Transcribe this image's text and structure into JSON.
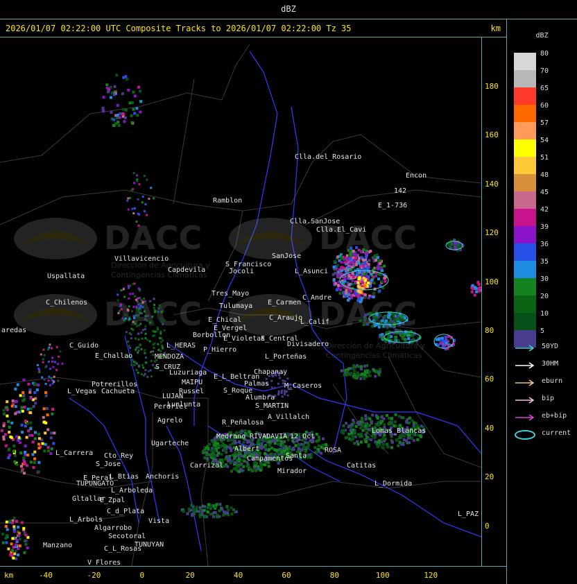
{
  "window": {
    "title": "dBZ"
  },
  "header": {
    "text": "2026/01/07 02:22:00 UTC Composite Tracks to 2026/01/07 02:22:00 Tz 35",
    "km_label": "km"
  },
  "colorbar": {
    "unit": "dBZ",
    "levels": [
      {
        "label": "80",
        "color": "#d8d8d8"
      },
      {
        "label": "70",
        "color": "#b8b8b8"
      },
      {
        "label": "65",
        "color": "#ff3a2a"
      },
      {
        "label": "60",
        "color": "#ff6a00"
      },
      {
        "label": "57",
        "color": "#ff9a5a"
      },
      {
        "label": "54",
        "color": "#ffff00"
      },
      {
        "label": "51",
        "color": "#ffc838"
      },
      {
        "label": "48",
        "color": "#d8903c"
      },
      {
        "label": "45",
        "color": "#c8688c"
      },
      {
        "label": "42",
        "color": "#c8148c"
      },
      {
        "label": "39",
        "color": "#8c14c8"
      },
      {
        "label": "36",
        "color": "#2850e8"
      },
      {
        "label": "35",
        "color": "#1e8ce0"
      },
      {
        "label": "30",
        "color": "#14821e"
      },
      {
        "label": "20",
        "color": "#0a6414"
      },
      {
        "label": "10",
        "color": "#06501a"
      },
      {
        "label": "5",
        "color": "#483c8c"
      }
    ]
  },
  "legend": [
    {
      "label": "50YD",
      "color": "#40d0d8"
    },
    {
      "label": "30HM",
      "color": "#ffffff"
    },
    {
      "label": "eburn",
      "color": "#f0c890"
    },
    {
      "label": "bip",
      "color": "#f0c8e0"
    },
    {
      "label": "eb+bip",
      "color": "#e040e0"
    },
    {
      "label": "current",
      "color": "#40d0d8"
    }
  ],
  "axes": {
    "y_ticks": [
      "180",
      "160",
      "140",
      "120",
      "100",
      "80",
      "60",
      "40",
      "20",
      "0"
    ],
    "x_ticks": [
      "-40",
      "-20",
      "0",
      "20",
      "40",
      "60",
      "80",
      "100",
      "120"
    ],
    "x_unit": "km",
    "y_unit": "km"
  },
  "watermark": {
    "name": "DACC",
    "line1": "Dirección de Agricultura y",
    "line2": "Contingencias Climáticas"
  },
  "places": [
    "Clla.del_Rosario",
    "Encon",
    "E_1-736",
    "142",
    "Ramblon",
    "Clla.SanJose",
    "Clla.El_Cavi",
    "Villavicencio",
    "Capdevila",
    "S_Francisco",
    "SanJose",
    "L_Asunci",
    "Uspallata",
    "Jocoli",
    "Tres_Mayo",
    "Tulumaya",
    "E_Carmen",
    "C_Andre",
    "C_Chilenos",
    "E_Chical",
    "E_Vergel",
    "C_Araujo",
    "L_Calif",
    "aredas",
    "E_Violetas",
    "Borbollon",
    "E_Central",
    "L_HERAS",
    "P_Hierro",
    "Divisadero",
    "C_Guido",
    "E_Challao",
    "MENDOZA",
    "L_Porteñas",
    "S_CRUZ",
    "Luzuriaga",
    "Chapanay",
    "E_L_Beltran",
    "Palmas",
    "M_Caseros",
    "Russel",
    "MAIPU",
    "Potrerillos",
    "L_Vegas",
    "Cachueta",
    "LUJAN",
    "S_Roque",
    "Alumbra",
    "Lunlunta",
    "Perdriel",
    "S_MARTIN",
    "Agrelo",
    "A_Villalch",
    "R_Peñalosa",
    "Ugarteche",
    "Medrano",
    "RIVADAVIA",
    "12_Oct",
    "Lomas_Blancas",
    "L_Carrera",
    "Cto_Rey",
    "S_Jose",
    "Albert",
    "Campamentos",
    "Carrizal",
    "Santa",
    "ROSA",
    "Catitas",
    "E_Peral",
    "L_Btias",
    "TUPUNGATO",
    "Anchoris",
    "Mirador",
    "L_Dormida",
    "L_Arboleda",
    "Gltallar",
    "E_Zpal",
    "C_d_Plata",
    "L_Arbols",
    "Vista",
    "Algarrobo",
    "Secotoral",
    "Manzano",
    "TUNUYAN",
    "C_L_Rosas",
    "V_Flores",
    "L_PAZ"
  ]
}
